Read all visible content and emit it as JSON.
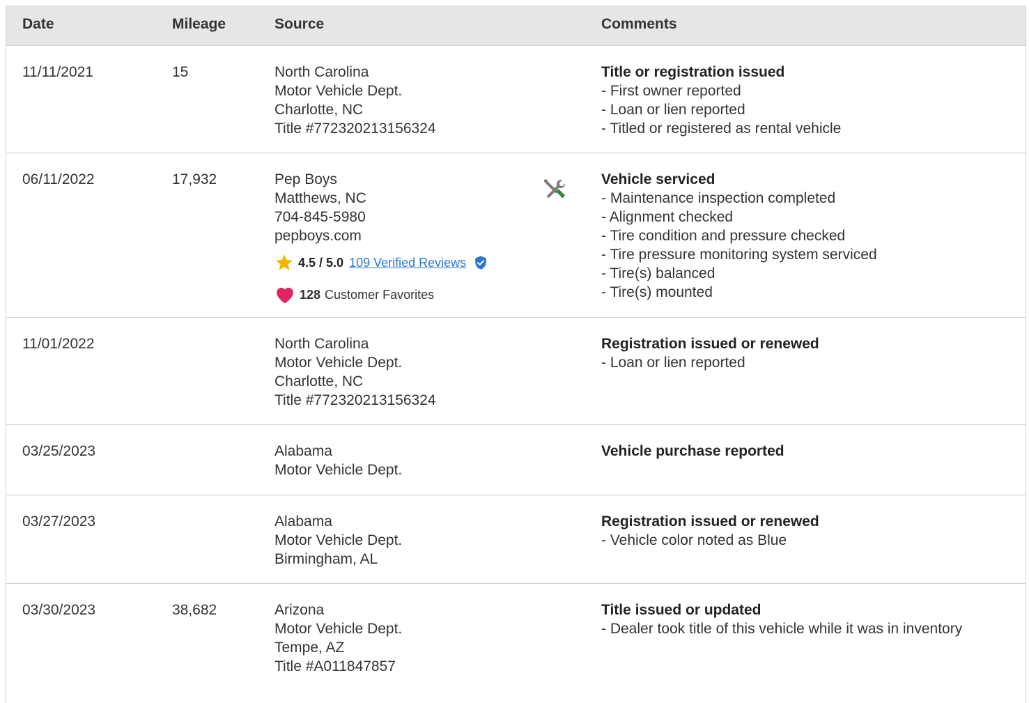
{
  "header": {
    "date": "Date",
    "mileage": "Mileage",
    "source": "Source",
    "comments": "Comments"
  },
  "rows": [
    {
      "date": "11/11/2021",
      "mileage": "15",
      "source": [
        "North Carolina",
        "Motor Vehicle Dept.",
        "Charlotte, NC",
        "Title #772320213156324"
      ],
      "title": "Title or registration issued",
      "items": [
        "- First owner reported",
        "- Loan or lien reported",
        "- Titled or registered as rental vehicle"
      ]
    },
    {
      "date": "06/11/2022",
      "mileage": "17,932",
      "source": [
        "Pep Boys",
        "Matthews, NC",
        "704-845-5980",
        "pepboys.com"
      ],
      "rating": "4.5 / 5.0",
      "reviews_link": "109 Verified Reviews",
      "favorites_count": "128",
      "favorites_label": "Customer Favorites",
      "title": "Vehicle serviced",
      "items": [
        "- Maintenance inspection completed",
        "- Alignment checked",
        "- Tire condition and pressure checked",
        "- Tire pressure monitoring system serviced",
        "- Tire(s) balanced",
        "- Tire(s) mounted"
      ]
    },
    {
      "date": "11/01/2022",
      "mileage": "",
      "source": [
        "North Carolina",
        "Motor Vehicle Dept.",
        "Charlotte, NC",
        "Title #772320213156324"
      ],
      "title": "Registration issued or renewed",
      "items": [
        "- Loan or lien reported"
      ]
    },
    {
      "date": "03/25/2023",
      "mileage": "",
      "source": [
        "Alabama",
        "Motor Vehicle Dept."
      ],
      "title": "Vehicle purchase reported",
      "items": []
    },
    {
      "date": "03/27/2023",
      "mileage": "",
      "source": [
        "Alabama",
        "Motor Vehicle Dept.",
        "Birmingham, AL"
      ],
      "title": "Registration issued or renewed",
      "items": [
        "- Vehicle color noted as Blue"
      ]
    },
    {
      "date": "03/30/2023",
      "mileage": "38,682",
      "source": [
        "Arizona",
        "Motor Vehicle Dept.",
        "Tempe, AZ",
        "Title #A011847857"
      ],
      "title": "Title issued or updated",
      "items": [
        "- Dealer took title of this vehicle while it was in inventory"
      ]
    }
  ],
  "icons": {
    "service": "tools-icon",
    "star": "star-icon",
    "verified": "verified-shield-icon",
    "favorite": "heart-icon"
  },
  "colors": {
    "link": "#2a78d0",
    "star": "#f5b400",
    "heart": "#e0245e",
    "wrench": "#2e8b3d",
    "header_bg": "#e6e6e6"
  }
}
